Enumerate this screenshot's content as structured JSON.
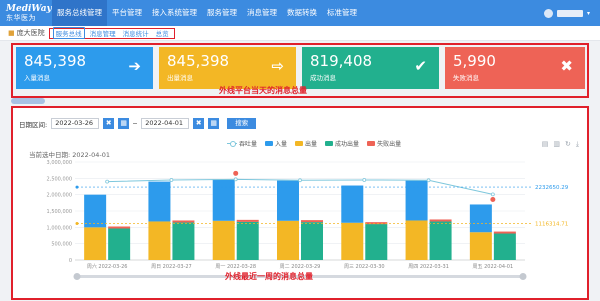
{
  "header": {
    "logo_line1": "MediWay",
    "logo_line2": "东华医为",
    "nav": [
      "服务总线管理",
      "平台管理",
      "接入系统管理",
      "服务管理",
      "消息管理",
      "数据转换",
      "标准管理"
    ],
    "caret": "▾"
  },
  "breadcrumb": {
    "home": "庞大医院",
    "tabs": [
      "服务总线",
      "消息管理",
      "消息统计",
      "总览"
    ]
  },
  "stats": {
    "cards": [
      {
        "value": "845,398",
        "label": "入量消息",
        "color": "#2d9bec",
        "icon": "sign-in-icon",
        "glyph": "➔"
      },
      {
        "value": "845,398",
        "label": "出量消息",
        "color": "#f3b725",
        "icon": "sign-out-icon",
        "glyph": "⇨"
      },
      {
        "value": "819,408",
        "label": "成功消息",
        "color": "#22b08e",
        "icon": "check-icon",
        "glyph": "✔"
      },
      {
        "value": "5,990",
        "label": "失败消息",
        "color": "#ee6356",
        "icon": "close-icon",
        "glyph": "✖"
      }
    ],
    "caption": "外线平台当天的消息总量"
  },
  "filter": {
    "label": "日期区间:",
    "start": "2022-03-26",
    "end": "2022-04-01",
    "clear_glyph": "✖",
    "calendar_glyph": "▦",
    "query_label": "搜索"
  },
  "chart": {
    "title_prefix": "当前选中日期: 2022-04-01",
    "legend": [
      "吞吐量",
      "入量",
      "出量",
      "成功出量",
      "失败出量"
    ],
    "caption": "外线最近一周的消息总量",
    "colors": {
      "in": "#2d9bec",
      "out": "#f3b725",
      "succ": "#22b08e",
      "fail": "#ee6356",
      "line": "#7ec7dc"
    }
  },
  "chart_data": {
    "type": "bar",
    "categories": [
      "周六 2022-03-26",
      "周日 2022-03-27",
      "周一 2022-03-28",
      "周二 2022-03-29",
      "周三 2022-03-30",
      "周四 2022-03-31",
      "周五 2022-04-01"
    ],
    "ylim": [
      0,
      3000000
    ],
    "yticks": [
      "0",
      "500,000",
      "1,000,000",
      "1,500,000",
      "2,000,000",
      "2,500,000",
      "3,000,000"
    ],
    "series": [
      {
        "name": "入量",
        "stack": "in",
        "values": [
          2000000,
          2400000,
          2470000,
          2430000,
          2280000,
          2430000,
          1700000
        ]
      },
      {
        "name": "出量",
        "stack": "out",
        "values": [
          1000000,
          1180000,
          1200000,
          1200000,
          1140000,
          1210000,
          850000
        ]
      },
      {
        "name": "成功出量",
        "stack": "succ",
        "values": [
          970000,
          1150000,
          1170000,
          1160000,
          1100000,
          1180000,
          820000
        ]
      },
      {
        "name": "失败出量",
        "stack": "fail",
        "values": [
          25000,
          30000,
          28000,
          30000,
          28000,
          30000,
          20000
        ]
      },
      {
        "name": "吞吐量",
        "type": "line",
        "values": [
          2400000,
          2450000,
          2470000,
          2440000,
          2450000,
          2440000,
          2010000
        ]
      }
    ],
    "markline_in": "2232650.29",
    "markline_out": "1116314.71",
    "markline_in_value": 2232650.29,
    "markline_out_value": 1116314.71
  }
}
